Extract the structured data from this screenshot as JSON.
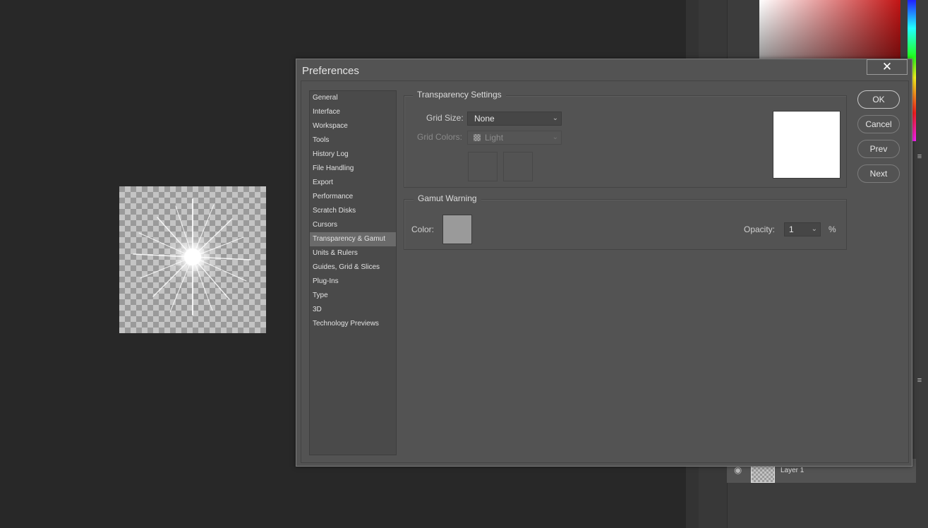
{
  "dialog": {
    "title": "Preferences",
    "close_glyph": "✕"
  },
  "nav": {
    "items": [
      {
        "label": "General"
      },
      {
        "label": "Interface"
      },
      {
        "label": "Workspace"
      },
      {
        "label": "Tools"
      },
      {
        "label": "History Log"
      },
      {
        "label": "File Handling"
      },
      {
        "label": "Export"
      },
      {
        "label": "Performance"
      },
      {
        "label": "Scratch Disks"
      },
      {
        "label": "Cursors"
      },
      {
        "label": "Transparency & Gamut"
      },
      {
        "label": "Units & Rulers"
      },
      {
        "label": "Guides, Grid & Slices"
      },
      {
        "label": "Plug-Ins"
      },
      {
        "label": "Type"
      },
      {
        "label": "3D"
      },
      {
        "label": "Technology Previews"
      }
    ],
    "selected": "Transparency & Gamut"
  },
  "transparency": {
    "group_label": "Transparency Settings",
    "grid_size_label": "Grid Size:",
    "grid_size_value": "None",
    "grid_colors_label": "Grid Colors:",
    "grid_colors_value": "Light"
  },
  "gamut": {
    "group_label": "Gamut Warning",
    "color_label": "Color:",
    "color_value": "#9a9a9a",
    "opacity_label": "Opacity:",
    "opacity_value": "1",
    "percent_sign": "%"
  },
  "buttons": {
    "ok": "OK",
    "cancel": "Cancel",
    "prev": "Prev",
    "next": "Next"
  },
  "layers": {
    "layer_name": "Layer 1"
  },
  "icons": {
    "panel_menu": "menu-icon",
    "eye": "eye-icon",
    "chevron": "chevron-down-icon"
  }
}
